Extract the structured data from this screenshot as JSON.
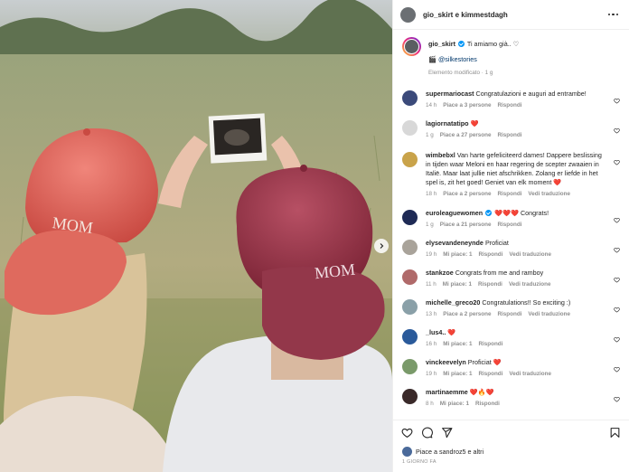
{
  "header": {
    "title": "gio_skirt e kimmestdagh"
  },
  "caption": {
    "username": "gio_skirt",
    "text": "Ti amiamo già.. ♡",
    "mention_emoji": "🎬",
    "mention": "@silkestories",
    "meta": "Elemento modificato · 1 g"
  },
  "photo": {
    "cap_text_1": "MOM",
    "cap_text_2": "MOM"
  },
  "comments": [
    {
      "username": "supermariocast",
      "text": "Congratulazioni e auguri ad entrambe!",
      "verified": false,
      "time": "14 h",
      "likes": "Piace a 3 persone",
      "reply": "Rispondi",
      "translate": "",
      "color": "#3b4a7a"
    },
    {
      "username": "lagiornatatipo",
      "text": "❤️",
      "verified": false,
      "time": "1 g",
      "likes": "Piace a 27 persone",
      "reply": "Rispondi",
      "translate": "",
      "color": "#d8d8d8"
    },
    {
      "username": "wimbebxl",
      "text": "Van harte gefeliciteerd dames! Dappere beslissing in tijden waar Meloni en haar regering de scepter zwaaien in Italië. Maar laat jullie niet afschrikken. Zolang er liefde in het spel is, zit het goed! Geniet van elk moment ❤️",
      "verified": false,
      "time": "18 h",
      "likes": "Piace a 2 persone",
      "reply": "Rispondi",
      "translate": "Vedi traduzione",
      "color": "#c9a34a"
    },
    {
      "username": "euroleaguewomen",
      "text": "❤️❤️❤️ Congrats!",
      "verified": true,
      "time": "1 g",
      "likes": "Piace a 21 persone",
      "reply": "Rispondi",
      "translate": "",
      "color": "#1e2a55"
    },
    {
      "username": "elysevandeneynde",
      "text": "Proficiat",
      "verified": false,
      "time": "19 h",
      "likes": "Mi piace: 1",
      "reply": "Rispondi",
      "translate": "Vedi traduzione",
      "color": "#a9a39a"
    },
    {
      "username": "stankzoe",
      "text": "Congrats from me and ramboy",
      "verified": false,
      "time": "11 h",
      "likes": "Mi piace: 1",
      "reply": "Rispondi",
      "translate": "Vedi traduzione",
      "color": "#b06a6a"
    },
    {
      "username": "michelle_greco20",
      "text": "Congratulations!! So exciting :)",
      "verified": false,
      "time": "13 h",
      "likes": "Piace a 2 persone",
      "reply": "Rispondi",
      "translate": "Vedi traduzione",
      "color": "#8aa0a8"
    },
    {
      "username": "_lus4..",
      "text": "❤️",
      "verified": false,
      "time": "16 h",
      "likes": "Mi piace: 1",
      "reply": "Rispondi",
      "translate": "",
      "color": "#2a5a9a"
    },
    {
      "username": "vinckeevelyn",
      "text": "Proficiat ❤️",
      "verified": false,
      "time": "19 h",
      "likes": "Mi piace: 1",
      "reply": "Rispondi",
      "translate": "Vedi traduzione",
      "color": "#7a9a6a"
    },
    {
      "username": "martinaemme",
      "text": "❤️🔥❤️",
      "verified": false,
      "time": "8 h",
      "likes": "Mi piace: 1",
      "reply": "Rispondi",
      "translate": "",
      "color": "#3a2a2a"
    }
  ],
  "footer": {
    "likes_text": "Piace a sandroz5 e altri",
    "date": "1 GIORNO FA"
  }
}
